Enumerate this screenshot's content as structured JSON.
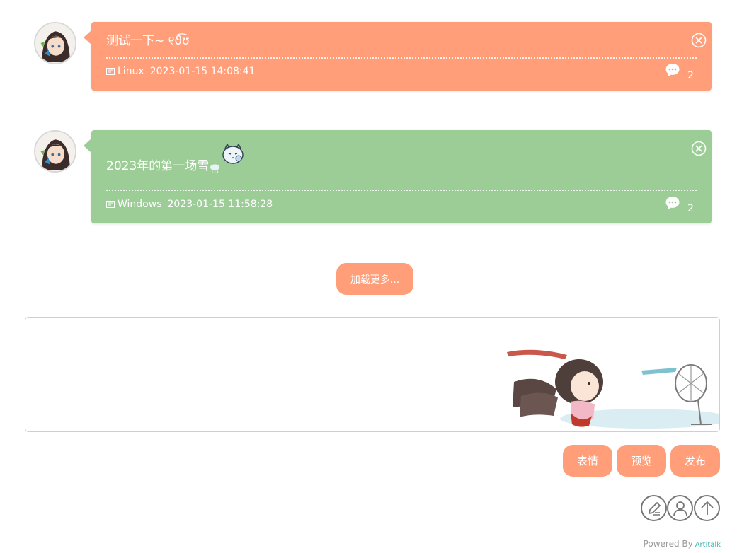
{
  "posts": [
    {
      "message": "测试一下~ ୧ϑ͡ʊ",
      "os": "Linux",
      "date": "2023-01-15 14:08:41",
      "comments": "2",
      "color": "#ff9e78"
    },
    {
      "message": "2023年的第一场雪",
      "os": "Windows",
      "date": "2023-01-15 11:58:28",
      "comments": "2",
      "color": "#9dcd97"
    }
  ],
  "load_more_label": "加载更多...",
  "editor": {
    "placeholder": ""
  },
  "actions": {
    "emoji_label": "表情",
    "preview_label": "预览",
    "publish_label": "发布"
  },
  "footer": {
    "powered_by": "Powered By",
    "brand": "Artitalk"
  },
  "colors": {
    "accent": "#ff9e78",
    "green": "#9dcd97"
  },
  "icons": [
    "close-icon",
    "comment-bubble-icon",
    "device-icon",
    "edit-icon",
    "user-icon",
    "arrow-up-icon",
    "snow-cloud-icon",
    "sticker-icon"
  ]
}
